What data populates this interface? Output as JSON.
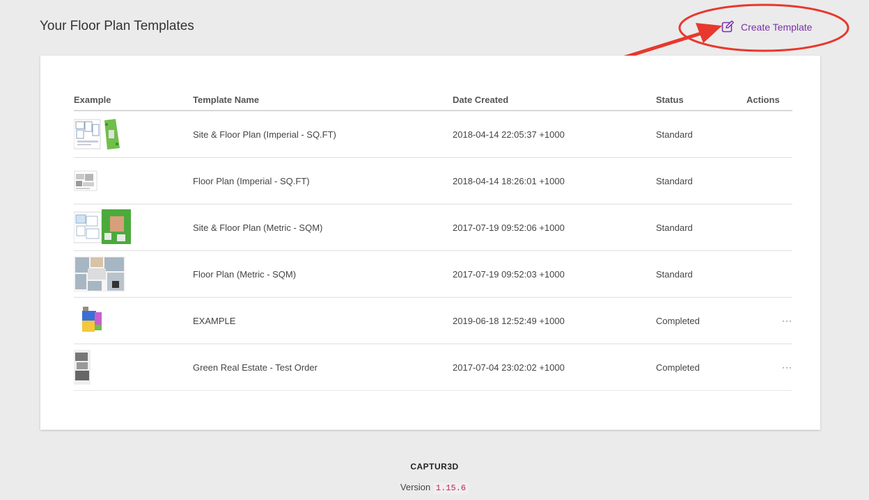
{
  "header": {
    "title": "Your Floor Plan Templates",
    "create_label": "Create Template"
  },
  "table": {
    "columns": [
      "Example",
      "Template Name",
      "Date Created",
      "Status",
      "Actions"
    ],
    "rows": [
      {
        "name": "Site & Floor Plan (Imperial - SQ.FT)",
        "date": "2018-04-14 22:05:37 +1000",
        "status": "Standard",
        "actions": ""
      },
      {
        "name": "Floor Plan (Imperial - SQ.FT)",
        "date": "2018-04-14 18:26:01 +1000",
        "status": "Standard",
        "actions": ""
      },
      {
        "name": "Site & Floor Plan (Metric - SQM)",
        "date": "2017-07-19 09:52:06 +1000",
        "status": "Standard",
        "actions": ""
      },
      {
        "name": "Floor Plan (Metric - SQM)",
        "date": "2017-07-19 09:52:03 +1000",
        "status": "Standard",
        "actions": ""
      },
      {
        "name": "EXAMPLE",
        "date": "2019-06-18 12:52:49 +1000",
        "status": "Completed",
        "actions": "···"
      },
      {
        "name": "Green Real Estate - Test Order",
        "date": "2017-07-04 23:02:02 +1000",
        "status": "Completed",
        "actions": "···"
      }
    ]
  },
  "footer": {
    "brand": "CAPTUR3D",
    "version_label": "Version",
    "version": "1.15.6"
  },
  "colors": {
    "accent": "#7a2fa8",
    "annotation": "#e8382d",
    "background": "#ebebeb"
  },
  "icons": {
    "create": "edit-pencil-square-icon"
  }
}
